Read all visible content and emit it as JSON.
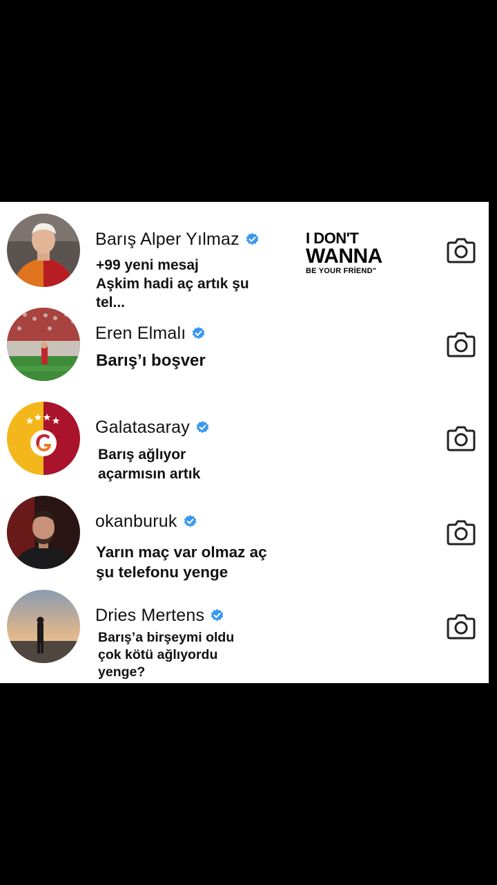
{
  "overlay": {
    "line1": "I DON'T",
    "line2": "WANNA",
    "line3": "BE YOUR FRİEND\""
  },
  "chats": [
    {
      "name": "Barış Alper Yılmaz",
      "verified": true,
      "message_lines": [
        "+99 yeni mesaj",
        "Aşkim hadi aç artık şu",
        "tel..."
      ],
      "avatar": "footballer-red-yellow-kit"
    },
    {
      "name": "Eren Elmalı",
      "verified": true,
      "message_lines": [
        "Barış’ı boşver"
      ],
      "avatar": "player-on-pitch"
    },
    {
      "name": "Galatasaray",
      "verified": true,
      "message_lines": [
        "Barış ağlıyor",
        "açarmısın artık"
      ],
      "avatar": "galatasaray-logo"
    },
    {
      "name": "okanburuk",
      "verified": true,
      "message_lines": [
        "Yarın maç var olmaz aç",
        "şu telefonu yenge"
      ],
      "avatar": "bearded-man-black-jacket"
    },
    {
      "name": "Dries Mertens",
      "verified": true,
      "message_lines": [
        "Barış’a birşeymi oldu",
        "çok kötü ağlıyordu",
        "yenge?"
      ],
      "avatar": "silhouette-at-sunset"
    }
  ],
  "icons": {
    "verified": "verified-badge-icon",
    "camera": "camera-icon"
  },
  "colors": {
    "verified": "#3897f0",
    "background": "#000000",
    "panel": "#ffffff"
  }
}
